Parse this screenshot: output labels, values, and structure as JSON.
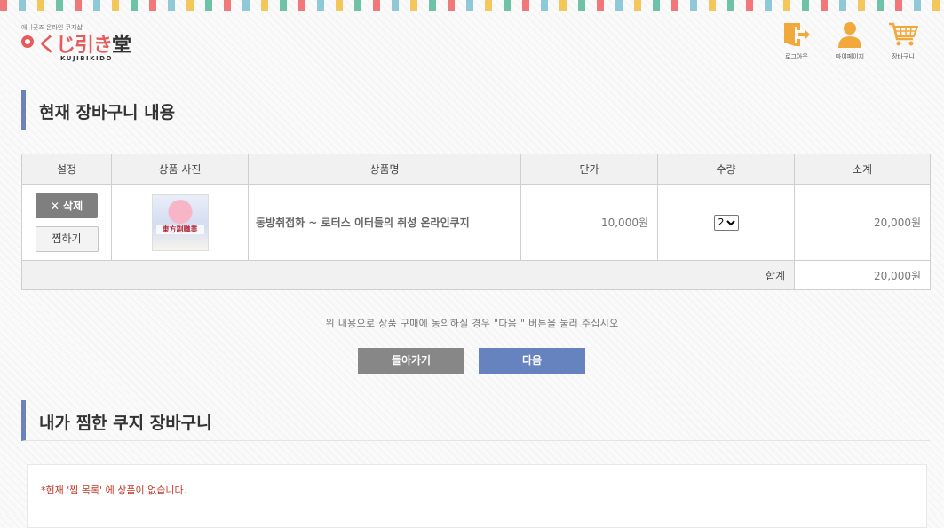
{
  "logo": {
    "small_text": "애니굿즈 온라인 쿠지샵",
    "brand": "くじ引き",
    "brand_suffix": "堂",
    "sub": "KUJIBIKIDO"
  },
  "header": {
    "icons": [
      {
        "label": "로그아웃",
        "icon": "logout-icon"
      },
      {
        "label": "마이페이지",
        "icon": "user-icon"
      },
      {
        "label": "장바구니",
        "icon": "cart-icon"
      }
    ]
  },
  "cart": {
    "title": "현재 장바구니 내용",
    "columns": [
      "설정",
      "상품 사진",
      "상품명",
      "단가",
      "수량",
      "소계"
    ],
    "items": [
      {
        "delete_label": "✕ 삭제",
        "fav_label": "찜하기",
        "thumb_title": "東方副職業",
        "name": "동방취접화 ~ 로터스 이터들의 취성 온라인쿠지",
        "price": "10,000원",
        "qty": "2",
        "subtotal": "20,000원"
      }
    ],
    "total_label": "합계",
    "total_value": "20,000원"
  },
  "notice": "위 내용으로 상품 구매에 동의하실 경우 \"다음 \"  버튼을 눌러 주십시오",
  "buttons": {
    "back": "돌아가기",
    "next": "다음"
  },
  "wishlist": {
    "title": "내가 찜한 쿠지 장바구니",
    "empty_message": "*현재 '찜 목록' 에 상품이 없습니다."
  },
  "colors": {
    "accent": "#6a84b8",
    "icon": "#f2a93b",
    "brand": "#e65b5b",
    "error": "#c0392b"
  }
}
